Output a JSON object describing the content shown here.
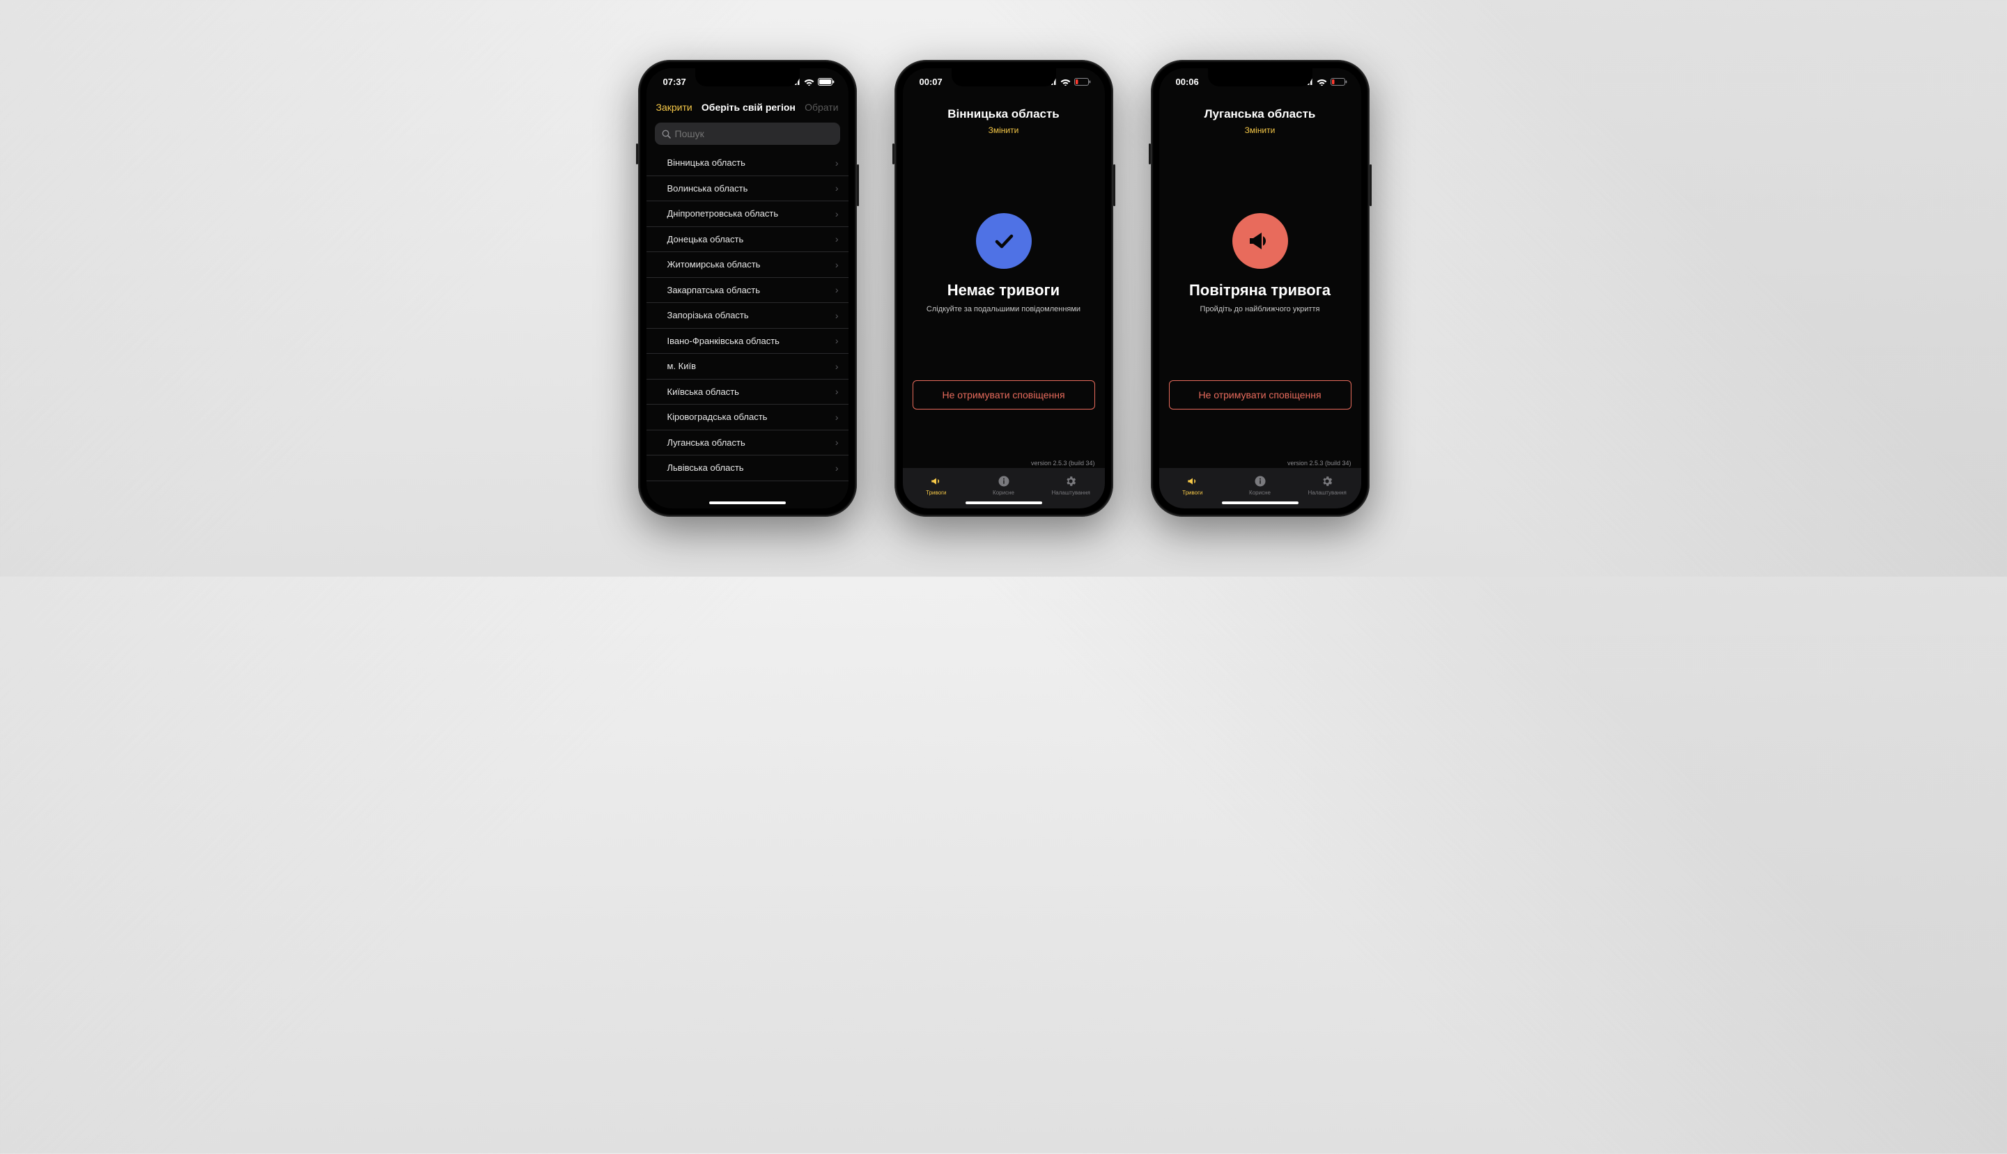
{
  "colors": {
    "accent": "#f7c948",
    "danger": "#e86b5c",
    "ok": "#4f72e5"
  },
  "phone1": {
    "time": "07:37",
    "nav": {
      "close": "Закрити",
      "title": "Оберіть свій регіон",
      "select": "Обрати"
    },
    "search": {
      "placeholder": "Пошук"
    },
    "regions": [
      "Вінницька область",
      "Волинська область",
      "Дніпропетровська область",
      "Донецька область",
      "Житомирська область",
      "Закарпатська область",
      "Запорізька область",
      "Івано-Франківська область",
      "м. Київ",
      "Київська область",
      "Кіровоградська область",
      "Луганська область",
      "Львівська область"
    ]
  },
  "phone2": {
    "time": "00:07",
    "region": "Вінницька область",
    "change": "Змінити",
    "status_title": "Немає тривоги",
    "status_sub": "Слідкуйте за подальшими повідомленнями",
    "button": "Не отримувати сповіщення",
    "version": "version 2.5.3 (build 34)"
  },
  "phone3": {
    "time": "00:06",
    "region": "Луганська область",
    "change": "Змінити",
    "status_title": "Повітряна тривога",
    "status_sub": "Пройдіть до найближчого укриття",
    "button": "Не отримувати сповіщення",
    "version": "version 2.5.3 (build 34)"
  },
  "tabs": {
    "alerts": "Тривоги",
    "useful": "Корисне",
    "settings": "Налаштування"
  }
}
